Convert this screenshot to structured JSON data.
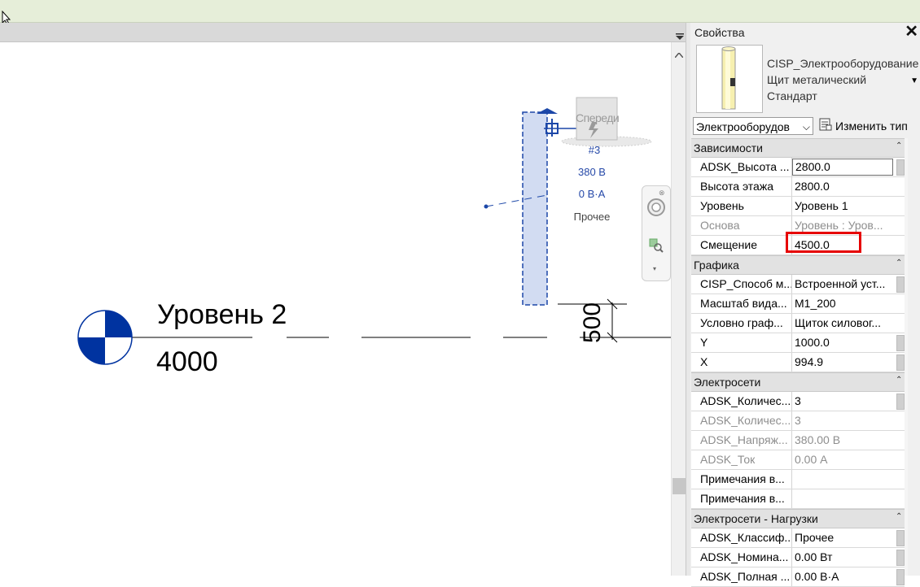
{
  "properties": {
    "title": "Свойства",
    "close_glyph": "✕",
    "type_name": "CISP_Электрооборудование  Щит металический Стандарт",
    "category": "Электрооборудов",
    "edit_type_label": "Изменить тип",
    "sections": [
      {
        "title": "Зависимости",
        "rows": [
          {
            "key": "ADSK_Высота ...",
            "value": "2800.0",
            "input": true
          },
          {
            "key": "Высота этажа",
            "value": "2800.0"
          },
          {
            "key": "Уровень",
            "value": "Уровень 1"
          },
          {
            "key": "Основа",
            "value": "Уровень : Уров...",
            "dim": true
          },
          {
            "key": "Смещение",
            "value": "4500.0"
          }
        ]
      },
      {
        "title": "Графика",
        "rows": [
          {
            "key": "CISP_Способ м...",
            "value": "Встроенной уст..."
          },
          {
            "key": "Масштаб вида...",
            "value": "М1_200"
          },
          {
            "key": "Условно граф...",
            "value": "Щиток силовог..."
          },
          {
            "key": "Y",
            "value": "1000.0"
          },
          {
            "key": "X",
            "value": "994.9"
          }
        ]
      },
      {
        "title": "Электросети",
        "rows": [
          {
            "key": "ADSK_Количес...",
            "value": "3"
          },
          {
            "key": "ADSK_Количес...",
            "value": "3",
            "dim": true
          },
          {
            "key": "ADSK_Напряж...",
            "value": "380.00 В",
            "dim": true
          },
          {
            "key": "ADSK_Ток",
            "value": "0.00 А",
            "dim": true
          },
          {
            "key": "Примечания в...",
            "value": ""
          },
          {
            "key": "Примечания в...",
            "value": ""
          }
        ]
      },
      {
        "title": "Электросети - Нагрузки",
        "rows": [
          {
            "key": "ADSK_Классиф...",
            "value": "Прочее"
          },
          {
            "key": "ADSK_Номина...",
            "value": "0.00 Вт"
          },
          {
            "key": "ADSK_Полная ...",
            "value": "0.00 В·А"
          }
        ]
      }
    ]
  },
  "canvas": {
    "level_name": "Уровень 2",
    "level_elevation": "4000",
    "dimension_value": "500",
    "view_cube_label": "Спереди",
    "tag_number": "#3",
    "tag_voltage": "380 В",
    "tag_load": "0 В·А",
    "tag_class": "Прочее"
  },
  "colors": {
    "highlight": "#e60000",
    "level_marker": "#0033a0",
    "element_fill": "#d2dcf2",
    "tag_text": "#2649a8"
  }
}
